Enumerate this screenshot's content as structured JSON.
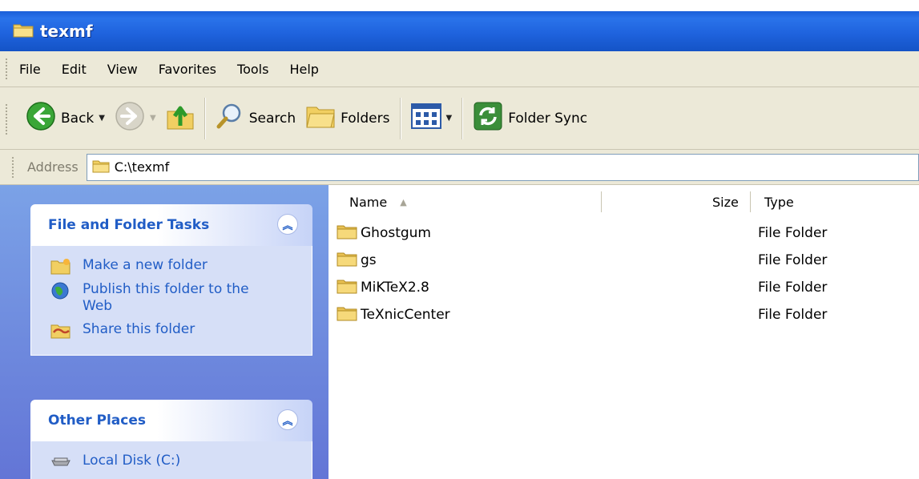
{
  "window": {
    "title": "texmf"
  },
  "menu": [
    "File",
    "Edit",
    "View",
    "Favorites",
    "Tools",
    "Help"
  ],
  "toolbar": {
    "back_label": "Back",
    "search_label": "Search",
    "folders_label": "Folders",
    "folder_sync_label": "Folder Sync"
  },
  "address": {
    "label": "Address",
    "path": "C:\\texmf"
  },
  "tasks_panel": {
    "title": "File and Folder Tasks",
    "items": [
      "Make a new folder",
      "Publish this folder to the Web",
      "Share this folder"
    ]
  },
  "places_panel": {
    "title": "Other Places",
    "items": [
      "Local Disk (C:)"
    ]
  },
  "columns": {
    "name": "Name",
    "size": "Size",
    "type": "Type"
  },
  "files": [
    {
      "name": "Ghostgum",
      "type": "File Folder"
    },
    {
      "name": "gs",
      "type": "File Folder"
    },
    {
      "name": "MiKTeX2.8",
      "type": "File Folder"
    },
    {
      "name": "TeXnicCenter",
      "type": "File Folder"
    }
  ],
  "colors": {
    "title_blue": "#1f63de",
    "task_link": "#215dc6",
    "pane_bg": "#6f8ddf",
    "chrome": "#ece9d8"
  }
}
